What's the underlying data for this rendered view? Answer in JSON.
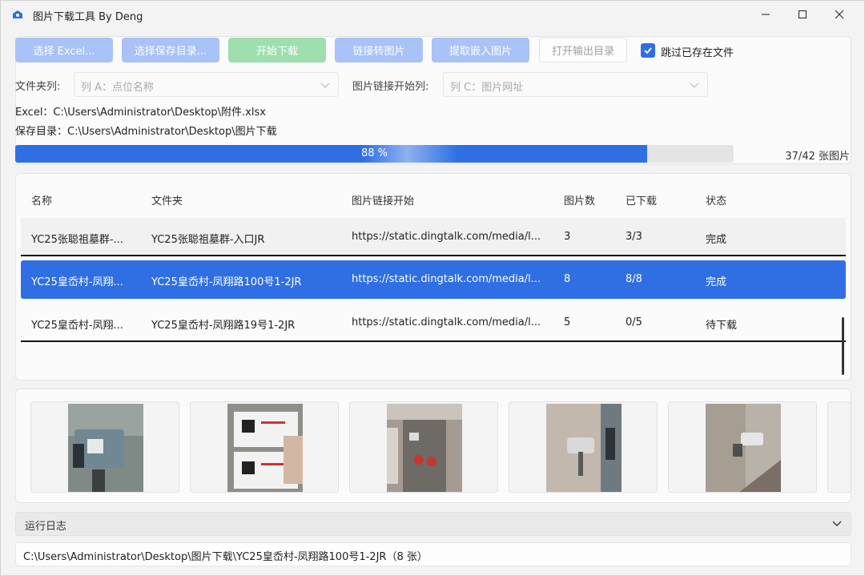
{
  "window": {
    "title": "图片下载工具 By Deng",
    "icon": "app-icon"
  },
  "toolbar": {
    "buttons": [
      {
        "label": "选择 Excel...",
        "state": "disabled"
      },
      {
        "label": "选择保存目录...",
        "state": "disabled"
      },
      {
        "label": "开始下载",
        "state": "disabled"
      },
      {
        "label": "链接转图片",
        "state": "disabled"
      },
      {
        "label": "提取嵌入图片",
        "state": "disabled"
      },
      {
        "label": "打开输出目录",
        "state": "disabled"
      }
    ],
    "skip_existing": {
      "label": "跳过已存在文件",
      "checked": true
    }
  },
  "columns": {
    "folder_label": "文件夹列:",
    "folder_value": "列 A：点位名称",
    "link_label": "图片链接开始列:",
    "link_value": "列 C：图片网址"
  },
  "paths": {
    "excel": "Excel：C:\\Users\\Administrator\\Desktop\\附件.xlsx",
    "save_dir": "保存目录：C:\\Users\\Administrator\\Desktop\\图片下载"
  },
  "progress": {
    "percent": 88,
    "text": "88 %",
    "count": "37/42 张图片"
  },
  "table": {
    "headers": [
      "名称",
      "文件夹",
      "图片链接开始",
      "图片数",
      "已下载",
      "状态"
    ],
    "rows": [
      [
        "YC25张聪祖墓群-...",
        "YC25张聪祖墓群-入口JR",
        "https://static.dingtalk.com/media/l...",
        "3",
        "3/3",
        "完成"
      ],
      [
        "YC25皇岙村-凤翔...",
        "YC25皇岙村-凤翔路100号1-2JR",
        "https://static.dingtalk.com/media/l...",
        "8",
        "8/8",
        "完成"
      ],
      [
        "YC25皇岙村-凤翔...",
        "YC25皇岙村-凤翔路19号1-2JR",
        "https://static.dingtalk.com/media/l...",
        "5",
        "0/5",
        "待下载"
      ]
    ],
    "selected_row": 1
  },
  "thumbnails": [
    "camera-photo-1",
    "label-card-photo",
    "building-wall-photo",
    "wall-camera-photo",
    "corner-camera-photo"
  ],
  "log": {
    "label": "运行日志"
  },
  "status": {
    "text": "C:\\Users\\Administrator\\Desktop\\图片下载\\YC25皇岙村-凤翔路100号1-2JR（8 张）"
  },
  "colors": {
    "accent": "#2f6fe3",
    "button_blue": "#a9c2f7",
    "button_green": "#9fdfae"
  }
}
